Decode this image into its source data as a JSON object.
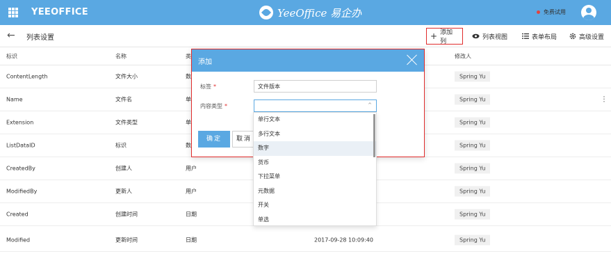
{
  "topbar": {
    "brand": "YEEOFFICE",
    "center_logo": "YeeOffice 易企办",
    "trial": "免费试用",
    "colors": {
      "bar": "#5aa8e2",
      "trial_dot": "#e3433e"
    }
  },
  "subbar": {
    "back_icon": "←",
    "title": "列表设置",
    "add_column": {
      "icon": "+",
      "label": "添加列"
    },
    "list_view": {
      "icon": "eye-icon",
      "label": "列表视图"
    },
    "form_layout": {
      "icon": "list-icon",
      "label": "表单布局"
    },
    "advanced": {
      "icon": "gear-icon",
      "label": "高级设置"
    }
  },
  "table": {
    "headers": {
      "id": "标识",
      "name": "名称",
      "type": "类",
      "modifier": "修改人"
    },
    "rows": [
      {
        "id": "ContentLength",
        "name": "文件大小",
        "type": "数",
        "time": "",
        "modifier": "Spring Yu"
      },
      {
        "id": "Name",
        "name": "文件名",
        "type": "单",
        "time": "",
        "modifier": "Spring Yu"
      },
      {
        "id": "Extension",
        "name": "文件类型",
        "type": "单",
        "time": "",
        "modifier": "Spring Yu"
      },
      {
        "id": "ListDataID",
        "name": "标识",
        "type": "数",
        "time": "",
        "modifier": "Spring Yu"
      },
      {
        "id": "CreatedBy",
        "name": "创建人",
        "type": "用户",
        "time": "",
        "modifier": "Spring Yu"
      },
      {
        "id": "ModifiedBy",
        "name": "更新人",
        "type": "用户",
        "time": "",
        "modifier": "Spring Yu"
      },
      {
        "id": "Created",
        "name": "创建时间",
        "type": "日期",
        "time": "",
        "modifier": "Spring Yu"
      },
      {
        "id": "Modified",
        "name": "更新时间",
        "type": "日期",
        "time": "2017-09-28 10:09:40",
        "modifier": "Spring Yu"
      }
    ],
    "kebab": "⋮"
  },
  "modal": {
    "title": "添加",
    "label_field": {
      "label": "标签",
      "required": "*",
      "value": "文件版本"
    },
    "type_field": {
      "label": "内容类型",
      "required": "*",
      "value": "",
      "caret": "^"
    },
    "ok": "确定",
    "cancel": "取消"
  },
  "dropdown": {
    "options": [
      "单行文本",
      "多行文本",
      "数字",
      "货币",
      "下拉菜单",
      "元数据",
      "开关",
      "单选"
    ],
    "active_index": 2
  }
}
